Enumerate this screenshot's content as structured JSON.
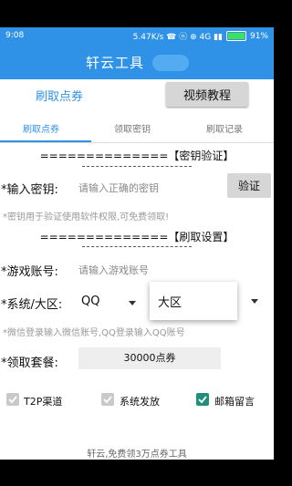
{
  "status": {
    "time": "9:08",
    "right": "5.47K/s  ☎ ⓝ ⊕ 4G ▮▮ ",
    "battery": "91%"
  },
  "app": {
    "title": "轩云工具"
  },
  "top": {
    "action_label": "刷取点券",
    "video_button": "视频教程"
  },
  "tabs": [
    "刷取点券",
    "领取密钥",
    "刷取记录"
  ],
  "verify": {
    "title": "==============【密钥验证】",
    "key_label": "*输入密钥:",
    "key_placeholder": "请输入正确的密钥",
    "verify_button": "验证",
    "hint": "*密钥用于验证使用软件权限,可免费领取!"
  },
  "settings": {
    "title": "==============【刷取设置】",
    "account_label": "*游戏账号:",
    "account_placeholder": "请输入游戏账号",
    "system_label": "*系统/大区:",
    "system_value": "QQ",
    "region_value": "大区",
    "hint": "*微信登录输入微信账号,QQ登录输入QQ账号",
    "package_label": "*领取套餐:",
    "package_value": "30000点券"
  },
  "options": [
    {
      "label": "T2P渠道",
      "checked": false
    },
    {
      "label": "系统发放",
      "checked": false
    },
    {
      "label": "邮箱留言",
      "checked": true
    }
  ],
  "footer": "轩云,免费领3万点券工具",
  "colors": {
    "accent": "#2f92e6",
    "checkbox_on": "#1f8f7c"
  }
}
